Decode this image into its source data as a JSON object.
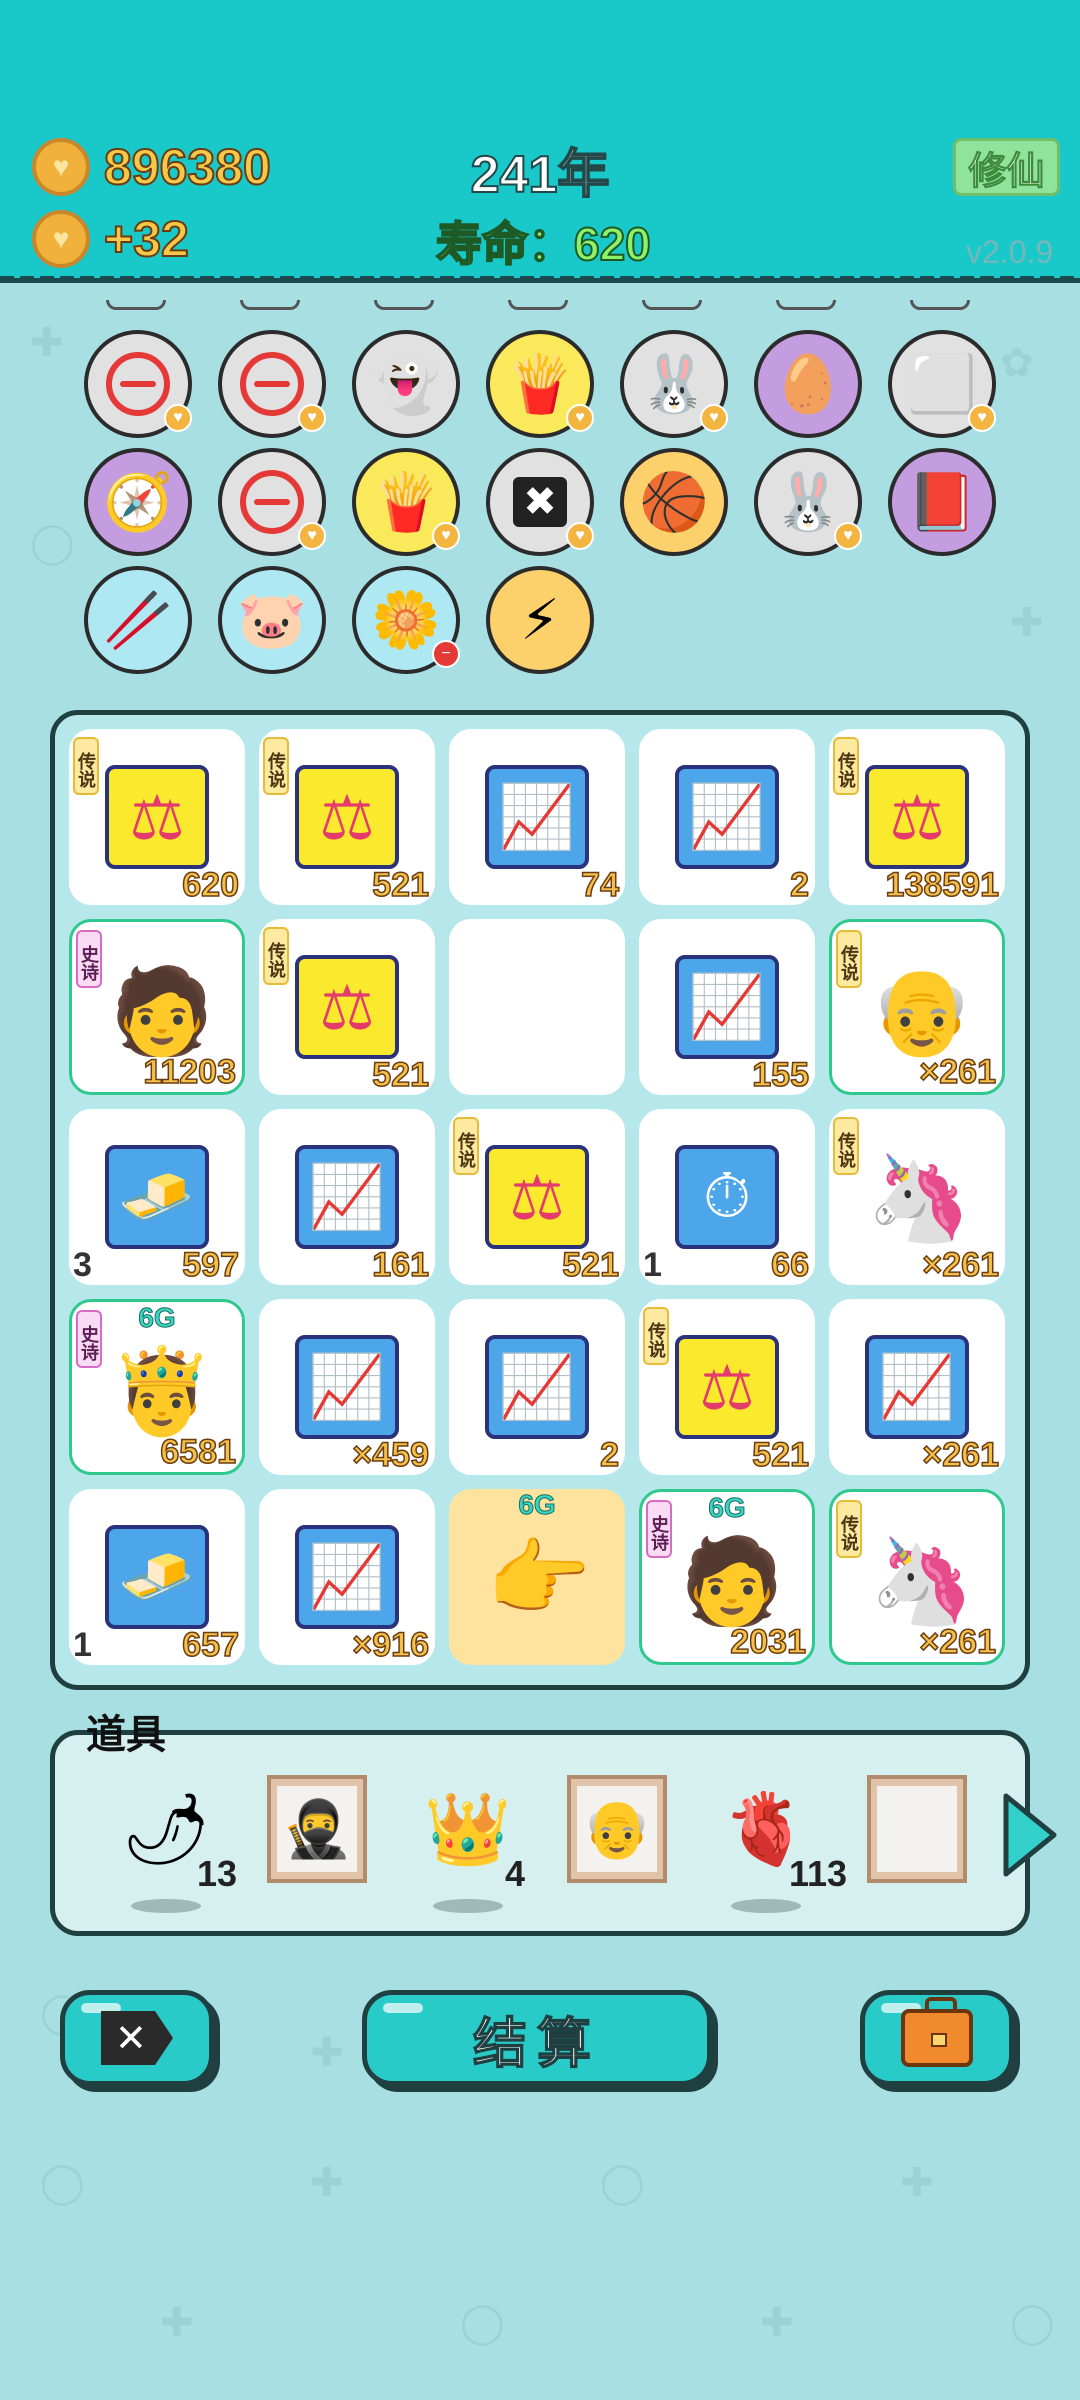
{
  "header": {
    "coins": "896380",
    "income": "+32",
    "year": "241年",
    "lifespan": "寿命：620",
    "cultivate_label": "修仙",
    "version": "v2.0.9"
  },
  "items_row1": [
    "minus",
    "minus",
    "ghost",
    "fries",
    "bunny",
    "egg",
    "cubes"
  ],
  "items_row2": [
    "compass",
    "minus",
    "fries",
    "delete",
    "basketball",
    "bunny",
    "time-magazine"
  ],
  "items_row3": [
    "sticks",
    "piggy-bank",
    "flower-pot",
    "lightning"
  ],
  "tags": {
    "legend": "传说",
    "epic": "史诗"
  },
  "grid": {
    "r0": [
      {
        "icon": "scale",
        "tag": "legend",
        "value": "620",
        "left": ""
      },
      {
        "icon": "scale",
        "tag": "legend",
        "value": "521",
        "left": ""
      },
      {
        "icon": "chart",
        "tag": "",
        "value": "74",
        "left": ""
      },
      {
        "icon": "chart",
        "tag": "",
        "value": "2",
        "left": ""
      },
      {
        "icon": "scale",
        "tag": "legend",
        "value": "138591",
        "left": ""
      }
    ],
    "r1": [
      {
        "icon": "green-hat-man",
        "tag": "epic",
        "value": "11203",
        "left": ""
      },
      {
        "icon": "scale",
        "tag": "legend",
        "value": "521",
        "left": ""
      },
      {
        "icon": "empty",
        "tag": "",
        "value": "",
        "left": ""
      },
      {
        "icon": "chart",
        "tag": "",
        "value": "155",
        "left": ""
      },
      {
        "icon": "old-man",
        "tag": "legend",
        "value": "×261",
        "left": ""
      }
    ],
    "r2": [
      {
        "icon": "gold-bars",
        "tag": "",
        "value": "597",
        "left": "3"
      },
      {
        "icon": "chart",
        "tag": "",
        "value": "161",
        "left": ""
      },
      {
        "icon": "scale",
        "tag": "legend",
        "value": "521",
        "left": ""
      },
      {
        "icon": "timer",
        "tag": "",
        "value": "66",
        "left": "1"
      },
      {
        "icon": "unicorn",
        "tag": "legend",
        "value": "×261",
        "left": ""
      }
    ],
    "r3": [
      {
        "icon": "crowned-man",
        "tag": "epic",
        "value": "6581",
        "left": "",
        "six": "6G"
      },
      {
        "icon": "chart",
        "tag": "",
        "value": "×459",
        "left": ""
      },
      {
        "icon": "chart",
        "tag": "",
        "value": "2",
        "left": ""
      },
      {
        "icon": "scale",
        "tag": "legend",
        "value": "521",
        "left": ""
      },
      {
        "icon": "chart",
        "tag": "",
        "value": "×261",
        "left": ""
      }
    ],
    "r4": [
      {
        "icon": "gold-bars",
        "tag": "",
        "value": "657",
        "left": "1"
      },
      {
        "icon": "chart",
        "tag": "",
        "value": "×916",
        "left": ""
      },
      {
        "icon": "pointing-hand",
        "tag": "",
        "value": "",
        "left": "",
        "six": "6G"
      },
      {
        "icon": "green-hat-man",
        "tag": "epic",
        "value": "2031",
        "left": "",
        "six": "6G"
      },
      {
        "icon": "crowned-unicorn",
        "tag": "legend",
        "value": "×261",
        "left": ""
      }
    ]
  },
  "props": {
    "label": "道具",
    "items": [
      {
        "icon": "chili-pepper",
        "count": "13"
      },
      {
        "icon": "thief-portrait",
        "count": ""
      },
      {
        "icon": "crown",
        "count": "4"
      },
      {
        "icon": "old-man-portrait",
        "count": ""
      },
      {
        "icon": "liver",
        "count": "113"
      },
      {
        "icon": "empty-frame",
        "count": ""
      }
    ]
  },
  "buttons": {
    "delete": "",
    "settle": "结算",
    "bag": ""
  },
  "colors": {
    "header_bg": "#19c8c8",
    "page_bg": "#a8dfe2",
    "coin_text": "#f6c84a",
    "life_text": "#8df26a"
  }
}
